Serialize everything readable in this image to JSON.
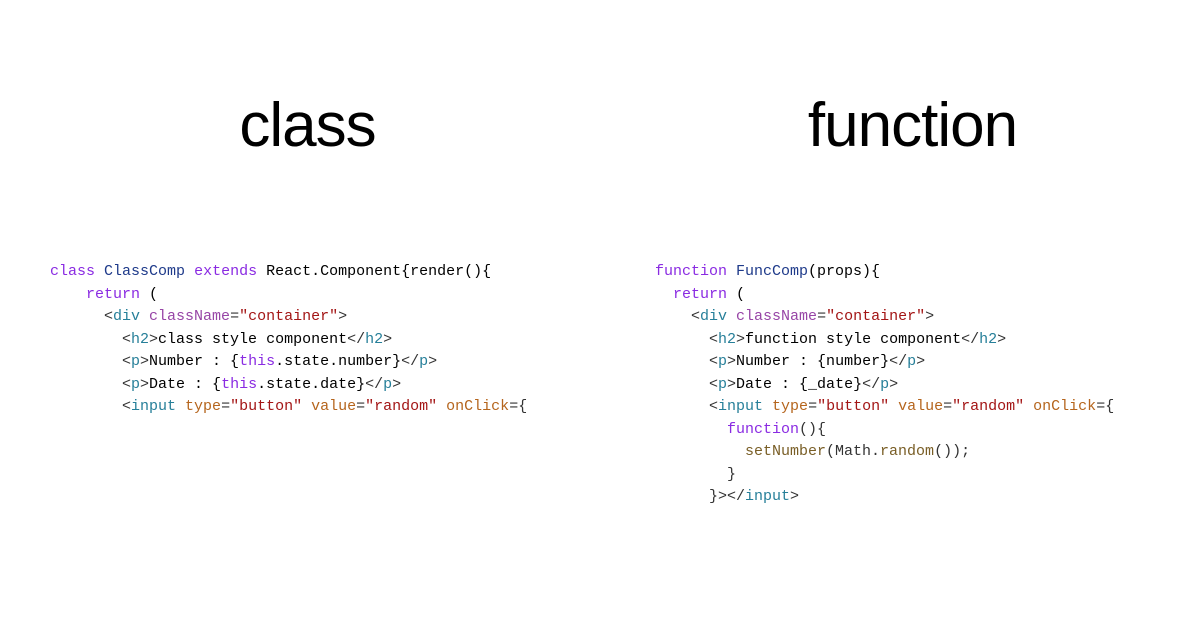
{
  "left": {
    "title": "class",
    "code": {
      "l1_kw1": "class",
      "l1_name": "ClassComp",
      "l1_kw2": "extends",
      "l1_react": "React.Component",
      "l1_tail": "{render(){",
      "l2_kw": "return",
      "l2_tail": " (",
      "l3_pre": "      <",
      "l3_tag": "div",
      "l3_sp": " ",
      "l3_attr": "className",
      "l3_eq": "=",
      "l3_str": "\"container\"",
      "l3_close": ">",
      "l4_pre": "        <",
      "l4_tag": "h2",
      "l4_gt": ">",
      "l4_txt": "class style component",
      "l4_end": "</",
      "l4_endtag": "h2",
      "l4_endgt": ">",
      "l5_pre": "        <",
      "l5_tag": "p",
      "l5_gt": ">",
      "l5_txt": "Number : {",
      "l5_this": "this",
      "l5_tail": ".state.number}",
      "l5_end": "</",
      "l5_endtag": "p",
      "l5_endgt": ">",
      "l6_pre": "        <",
      "l6_tag": "p",
      "l6_gt": ">",
      "l6_txt": "Date : {",
      "l6_this": "this",
      "l6_tail": ".state.date}",
      "l6_end": "</",
      "l6_endtag": "p",
      "l6_endgt": ">",
      "l7_pre": "        <",
      "l7_tag": "input",
      "l7_sp1": " ",
      "l7_attr1": "type",
      "l7_eq1": "=",
      "l7_str1": "\"button\"",
      "l7_sp2": " ",
      "l7_attr2": "value",
      "l7_eq2": "=",
      "l7_str2": "\"random\"",
      "l7_sp3": " ",
      "l7_attr3": "onClick",
      "l7_eq3": "={"
    }
  },
  "right": {
    "title": "function",
    "code": {
      "l1_kw": "function",
      "l1_name": "FuncComp",
      "l1_tail": "(props){",
      "l2_kw": "return",
      "l2_tail": " (",
      "l3_pre": "    <",
      "l3_tag": "div",
      "l3_sp": " ",
      "l3_attr": "className",
      "l3_eq": "=",
      "l3_str": "\"container\"",
      "l3_close": ">",
      "l4_pre": "      <",
      "l4_tag": "h2",
      "l4_gt": ">",
      "l4_txt": "function style component",
      "l4_end": "</",
      "l4_endtag": "h2",
      "l4_endgt": ">",
      "l5_pre": "      <",
      "l5_tag": "p",
      "l5_gt": ">",
      "l5_txt": "Number : {number}",
      "l5_end": "</",
      "l5_endtag": "p",
      "l5_endgt": ">",
      "l6_pre": "      <",
      "l6_tag": "p",
      "l6_gt": ">",
      "l6_txt": "Date : {_date}",
      "l6_end": "</",
      "l6_endtag": "p",
      "l6_endgt": ">",
      "l7_pre": "      <",
      "l7_tag": "input",
      "l7_sp1": " ",
      "l7_attr1": "type",
      "l7_eq1": "=",
      "l7_str1": "\"button\"",
      "l7_sp2": " ",
      "l7_attr2": "value",
      "l7_eq2": "=",
      "l7_str2": "\"random\"",
      "l7_sp3": " ",
      "l7_attr3": "onClick",
      "l7_eq3": "={",
      "l8_pre": "        ",
      "l8_kw": "function",
      "l8_tail": "(){",
      "l9_pre": "          ",
      "l9_fn": "setNumber",
      "l9_paren": "(Math.",
      "l9_rand": "random",
      "l9_tail": "());",
      "l10": "        }",
      "l11_pre": "      }>",
      "l11_end": "</",
      "l11_tag": "input",
      "l11_gt": ">"
    }
  }
}
